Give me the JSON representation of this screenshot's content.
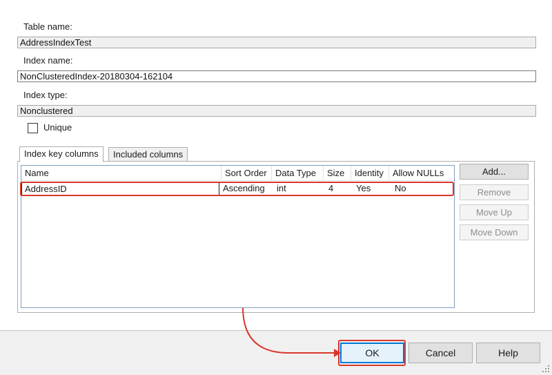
{
  "form": {
    "table_name_label": "Table name:",
    "table_name_value": "AddressIndexTest",
    "index_name_label": "Index name:",
    "index_name_value": "NonClusteredIndex-20180304-162104",
    "index_type_label": "Index type:",
    "index_type_value": "Nonclustered",
    "unique_label": "Unique"
  },
  "tabs": [
    {
      "label": "Index key columns",
      "active": true
    },
    {
      "label": "Included columns",
      "active": false
    }
  ],
  "grid": {
    "columns": [
      "Name",
      "Sort Order",
      "Data Type",
      "Size",
      "Identity",
      "Allow NULLs"
    ],
    "rows": [
      {
        "name": "AddressID",
        "sort_order": "Ascending",
        "data_type": "int",
        "size": "4",
        "identity": "Yes",
        "allow_nulls": "No"
      }
    ]
  },
  "side_buttons": {
    "add": "Add...",
    "remove": "Remove",
    "move_up": "Move Up",
    "move_down": "Move Down"
  },
  "footer": {
    "ok": "OK",
    "cancel": "Cancel",
    "help": "Help"
  },
  "colors": {
    "highlight": "#d9362a",
    "focus": "#0078d7"
  }
}
